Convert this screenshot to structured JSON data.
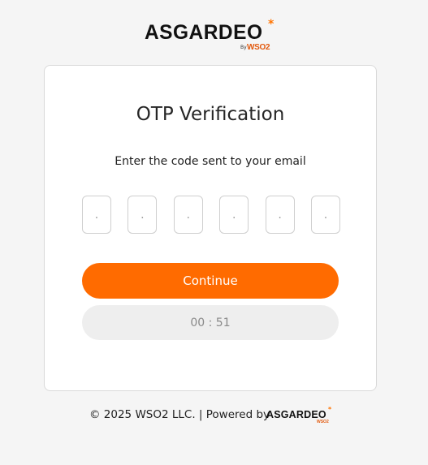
{
  "brand": {
    "wordmark": "ASGARDEO",
    "by": "By",
    "wso2": "WSO2",
    "star": "*"
  },
  "card": {
    "title": "OTP Verification",
    "subtitle": "Enter the code sent to your email",
    "otp_placeholders": [
      ".",
      ".",
      ".",
      ".",
      ".",
      "."
    ],
    "otp_values": [
      "",
      "",
      "",
      "",
      "",
      ""
    ],
    "continue_label": "Continue",
    "timer_label": "00 : 51"
  },
  "footer": {
    "text": "© 2025 WSO2 LLC. | Powered by",
    "logo_wordmark": "ASGARDEO",
    "logo_wso2": "WSO2",
    "logo_star": "*"
  },
  "colors": {
    "accent": "#ff6b00",
    "background": "#f5f5f5",
    "card": "#ffffff",
    "timer_bg": "#eeeeee"
  }
}
